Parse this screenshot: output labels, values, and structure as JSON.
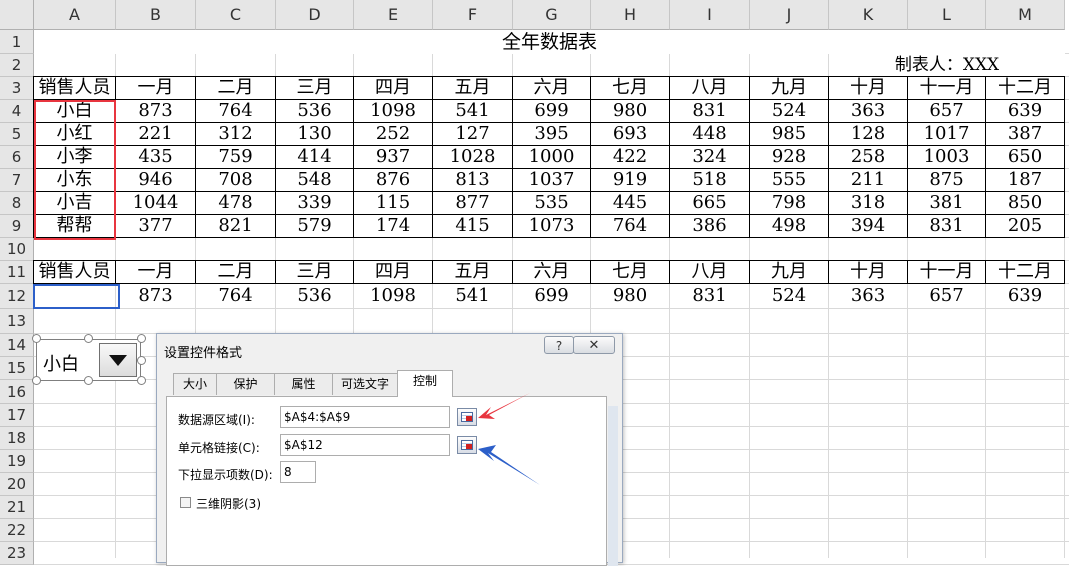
{
  "columns": [
    "A",
    "B",
    "C",
    "D",
    "E",
    "F",
    "G",
    "H",
    "I",
    "J",
    "K",
    "L",
    "M"
  ],
  "rows": [
    "1",
    "2",
    "3",
    "4",
    "5",
    "6",
    "7",
    "8",
    "9",
    "10",
    "11",
    "12",
    "13",
    "14",
    "15",
    "16",
    "17",
    "18",
    "19",
    "20",
    "21",
    "22",
    "23"
  ],
  "sheet": {
    "title": "全年数据表",
    "maker": "制表人：XXX",
    "header": [
      "销售人员",
      "一月",
      "二月",
      "三月",
      "四月",
      "五月",
      "六月",
      "七月",
      "八月",
      "九月",
      "十月",
      "十一月",
      "十二月"
    ],
    "data": [
      [
        "小白",
        "873",
        "764",
        "536",
        "1098",
        "541",
        "699",
        "980",
        "831",
        "524",
        "363",
        "657",
        "639"
      ],
      [
        "小红",
        "221",
        "312",
        "130",
        "252",
        "127",
        "395",
        "693",
        "448",
        "985",
        "128",
        "1017",
        "387"
      ],
      [
        "小李",
        "435",
        "759",
        "414",
        "937",
        "1028",
        "1000",
        "422",
        "324",
        "928",
        "258",
        "1003",
        "650"
      ],
      [
        "小东",
        "946",
        "708",
        "548",
        "876",
        "813",
        "1037",
        "919",
        "518",
        "555",
        "211",
        "875",
        "187"
      ],
      [
        "小吉",
        "1044",
        "478",
        "339",
        "115",
        "877",
        "535",
        "445",
        "665",
        "798",
        "318",
        "381",
        "850"
      ],
      [
        "帮帮",
        "377",
        "821",
        "579",
        "174",
        "415",
        "1073",
        "764",
        "386",
        "498",
        "394",
        "831",
        "205"
      ]
    ],
    "header2": [
      "销售人员",
      "一月",
      "二月",
      "三月",
      "四月",
      "五月",
      "六月",
      "七月",
      "八月",
      "九月",
      "十月",
      "十一月",
      "十二月"
    ],
    "row12": [
      "",
      "873",
      "764",
      "536",
      "1098",
      "541",
      "699",
      "980",
      "831",
      "524",
      "363",
      "657",
      "639"
    ]
  },
  "combo": {
    "value": "小白"
  },
  "dialog": {
    "title": "设置控件格式",
    "help": "?",
    "close": "✕",
    "tabs": [
      "大小",
      "保护",
      "属性",
      "可选文字",
      "控制"
    ],
    "active_tab": "控制",
    "source_label": "数据源区域(I):",
    "source_value": "$A$4:$A$9",
    "link_label": "单元格链接(C):",
    "link_value": "$A$12",
    "dropdown_lines_label": "下拉显示项数(D):",
    "dropdown_lines_value": "8",
    "shading_label": "三维阴影(3)"
  },
  "colors": {
    "red_arrow": "#e8353f",
    "blue_arrow": "#2c5fc9"
  }
}
